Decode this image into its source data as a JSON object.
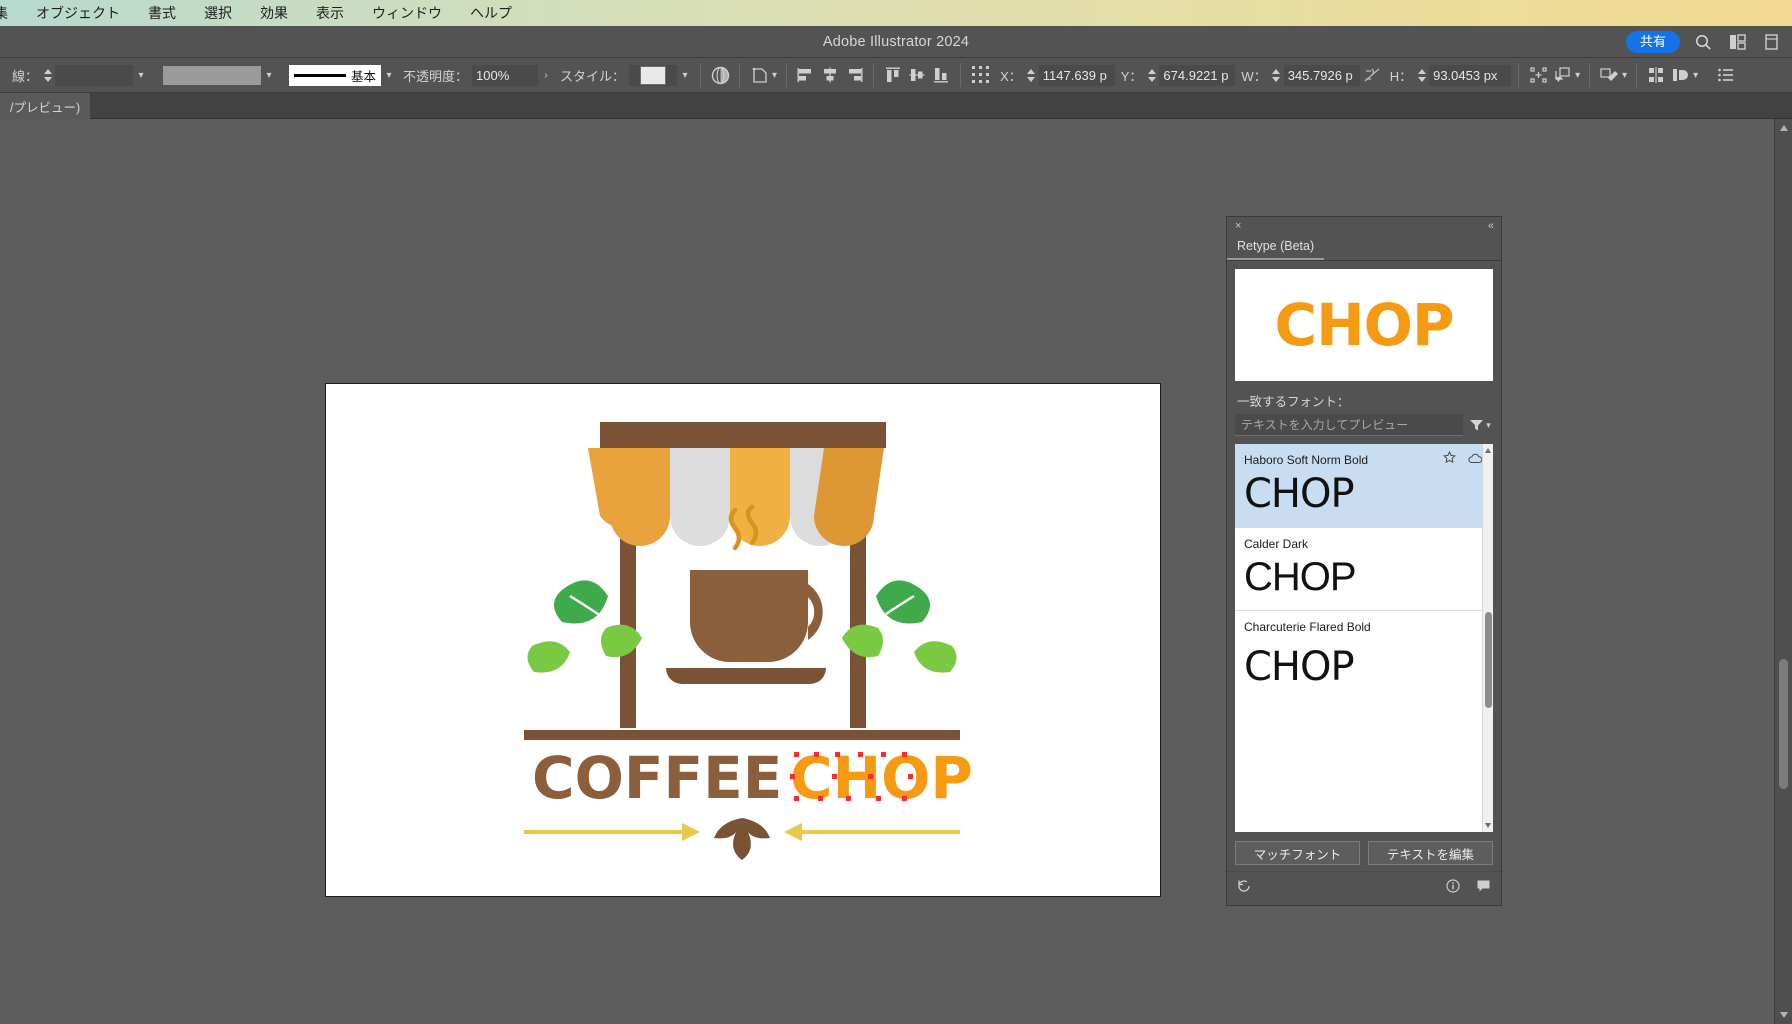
{
  "menubar": {
    "items": [
      {
        "label": "集",
        "name": "menu-edit"
      },
      {
        "label": "オブジェクト",
        "name": "menu-object"
      },
      {
        "label": "書式",
        "name": "menu-type"
      },
      {
        "label": "選択",
        "name": "menu-select"
      },
      {
        "label": "効果",
        "name": "menu-effect"
      },
      {
        "label": "表示",
        "name": "menu-view"
      },
      {
        "label": "ウィンドウ",
        "name": "menu-window"
      },
      {
        "label": "ヘルプ",
        "name": "menu-help"
      }
    ]
  },
  "titlebar": {
    "app_title": "Adobe Illustrator 2024",
    "share_label": "共有",
    "icons": [
      "search-icon",
      "workspace-layout-icon",
      "panel-toggle-icon"
    ]
  },
  "controlbar": {
    "stroke_label": "線：",
    "stroke_weight_value": "",
    "fill_swatch_value": "",
    "stroke_profile_label": "基本",
    "opacity_label": "不透明度：",
    "opacity_value": "100%",
    "style_label": "スタイル：",
    "x_label": "X：",
    "x_value": "1147.639 p",
    "y_label": "Y：",
    "y_value": "674.9221 p",
    "w_label": "W：",
    "w_value": "345.7926 p",
    "h_label": "H：",
    "h_value": "93.0453 px",
    "unit": "px"
  },
  "tabbar": {
    "document_tab": "/プレビュー)"
  },
  "retype_panel": {
    "title": "Retype (Beta)",
    "close_label": "×",
    "collapse_label": "«",
    "preview_text": "CHOP",
    "preview_color": "#f59a13",
    "match_fonts_label": "一致するフォント：",
    "search_placeholder": "テキストを入力してプレビュー",
    "font_list": [
      {
        "name": "Haboro Soft Norm Bold",
        "sample": "CHOP",
        "selected": true,
        "has_star": true,
        "has_cloud": true
      },
      {
        "name": "Calder Dark",
        "sample": "CHOP",
        "selected": false,
        "has_star": false,
        "has_cloud": false
      },
      {
        "name": "Charcuterie Flared Bold",
        "sample": "CHOP",
        "selected": false,
        "has_star": false,
        "has_cloud": false
      }
    ],
    "match_font_button": "マッチフォント",
    "edit_text_button": "テキストを編集",
    "footer_icons": [
      "reset-icon",
      "info-icon",
      "feedback-icon"
    ]
  },
  "artwork": {
    "brand_primary": "COFFEE",
    "brand_secondary": "CHOP",
    "colors": {
      "brown": "#8b5e3c",
      "dark_brown": "#7a5236",
      "awning_orange": "#e8a33d",
      "awning_gold": "#f0b042",
      "awning_grey": "#dcdcdc",
      "leaf_dark": "#3faa4b",
      "leaf_light": "#7ac943",
      "chop_orange": "#f59a13",
      "anchor_red": "#ff2a2a",
      "arrow_gold": "#e8c84a"
    }
  }
}
